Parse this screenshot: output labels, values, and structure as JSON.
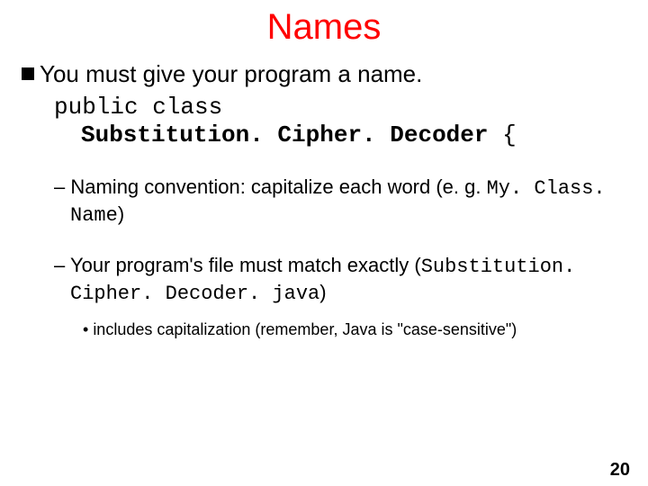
{
  "title": "Names",
  "main": {
    "text": "You must give your program a name."
  },
  "code": {
    "line1": "public class",
    "line2_bold": "Substitution. Cipher. Decoder",
    "line2_tail": " {"
  },
  "sub1": {
    "dash": "– ",
    "t1": "Naming convention: capitalize each word (e. g. ",
    "mono": "My. Class. Name",
    "t2": ")"
  },
  "sub2": {
    "dash": "– ",
    "t1": "Your program's file must match exactly (",
    "mono": "Substitution. Cipher. Decoder. java",
    "t2": ")"
  },
  "sub2b": {
    "dot": "• ",
    "text": "includes capitalization (remember, Java is \"case-sensitive\")"
  },
  "page": "20"
}
